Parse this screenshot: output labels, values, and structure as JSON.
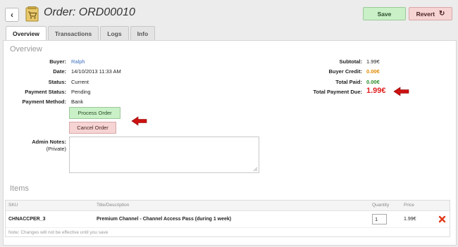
{
  "header": {
    "back_label": "‹",
    "title": "Order: ORD00010",
    "save_label": "Save",
    "revert_label": "Revert",
    "revert_icon": "↻"
  },
  "tabs": [
    {
      "label": "Overview",
      "active": true
    },
    {
      "label": "Transactions",
      "active": false
    },
    {
      "label": "Logs",
      "active": false
    },
    {
      "label": "Info",
      "active": false
    }
  ],
  "overview": {
    "section_title": "Overview",
    "fields": [
      {
        "label": "Buyer:",
        "value": "Ralph"
      },
      {
        "label": "Date:",
        "value": "14/10/2013 11:33 AM"
      },
      {
        "label": "Status:",
        "value": "Current"
      },
      {
        "label": "Payment Status:",
        "value": "Pending"
      },
      {
        "label": "Payment Method:",
        "value": "Bank"
      }
    ],
    "totals": [
      {
        "label": "Subtotal:",
        "value": "1.99€"
      },
      {
        "label": "Buyer Credit:",
        "value": "0.00€"
      },
      {
        "label": "Total Paid:",
        "value": "0.00€"
      },
      {
        "label": "Total Payment Due:",
        "value": "1.99€"
      }
    ],
    "process_order_label": "Process Order",
    "cancel_order_label": "Cancel Order",
    "admin_notes_label": "Admin Notes:",
    "admin_notes_sub": "(Private)",
    "admin_notes_value": ""
  },
  "items": {
    "section_title": "Items",
    "columns": [
      "SKU",
      "Title/Description",
      "Quantity",
      "Price"
    ],
    "rows": [
      {
        "sku": "CHNACCPER_3",
        "title": "Premium Channel - Channel Access Pass (during 1 week)",
        "quantity": "1",
        "price": "1.99€"
      }
    ],
    "note": "Note: Changes will not be effective until you save"
  },
  "colors": {
    "link_blue": "#3a6fbf",
    "credit_orange": "#e08a00",
    "paid_green": "#2a8a2a",
    "due_red": "#e02020",
    "arrow_red": "#cc1111",
    "save_green": "#c9f0c6",
    "revert_pink": "#f6d4d4"
  },
  "icons": [
    "back-icon",
    "shopping-cart-icon",
    "refresh-icon",
    "arrow-left-icon",
    "remove-x-icon",
    "resize-grip-icon"
  ]
}
